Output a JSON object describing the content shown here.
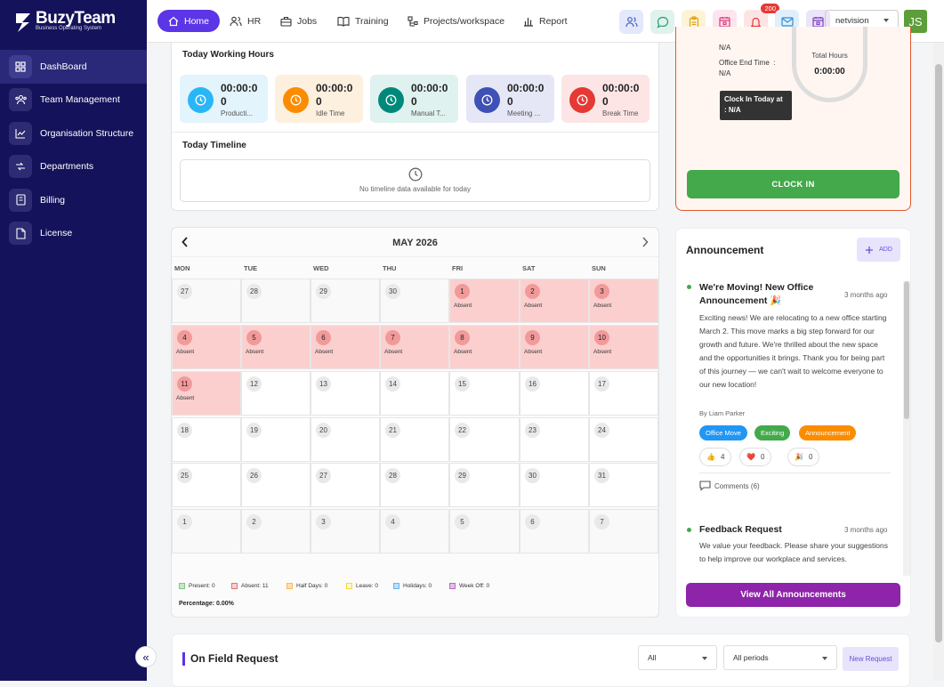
{
  "brand": {
    "name": "BuzyTeam",
    "tagline": "Business Operating System"
  },
  "sidebar": {
    "items": [
      {
        "label": "DashBoard",
        "icon": "grid-icon",
        "active": true
      },
      {
        "label": "Team Management",
        "icon": "team-icon"
      },
      {
        "label": "Organisation Structure",
        "icon": "chart-icon"
      },
      {
        "label": "Departments",
        "icon": "departments-icon"
      },
      {
        "label": "Billing",
        "icon": "billing-icon"
      },
      {
        "label": "License",
        "icon": "license-icon"
      }
    ],
    "collapse": "«"
  },
  "topnav": {
    "home": "Home",
    "hr": "HR",
    "jobs": "Jobs",
    "training": "Training",
    "projects": "Projects/workspace",
    "report": "Report"
  },
  "topbar": {
    "notification_count": "200",
    "org": "netvision",
    "avatar": "JS"
  },
  "working_hours": {
    "title": "Today Working Hours",
    "tiles": [
      {
        "value": "00:00:00",
        "label": "Producti...",
        "color": "#29b6f6",
        "bg": "#e3f4fc"
      },
      {
        "value": "00:00:00",
        "label": "Idle Time",
        "color": "#fb8c00",
        "bg": "#fdf0df"
      },
      {
        "value": "00:00:00",
        "label": "Manual T...",
        "color": "#00897b",
        "bg": "#dff2ef"
      },
      {
        "value": "00:00:00",
        "label": "Meeting ...",
        "color": "#3f51b5",
        "bg": "#e5e7f6"
      },
      {
        "value": "00:00:00",
        "label": "Break Time",
        "color": "#e53935",
        "bg": "#fde5e5"
      }
    ]
  },
  "timeline": {
    "title": "Today Timeline",
    "empty": "No timeline data available for today"
  },
  "calendar": {
    "month": "MAY 2026",
    "weekdays": [
      "MON",
      "TUE",
      "WED",
      "THU",
      "FRI",
      "SAT",
      "SUN"
    ],
    "weeks": [
      [
        {
          "d": "27",
          "m": 1
        },
        {
          "d": "28",
          "m": 1
        },
        {
          "d": "29",
          "m": 1
        },
        {
          "d": "30",
          "m": 1
        },
        {
          "d": "1",
          "s": "Absent"
        },
        {
          "d": "2",
          "s": "Absent"
        },
        {
          "d": "3",
          "s": "Absent"
        }
      ],
      [
        {
          "d": "4",
          "s": "Absent"
        },
        {
          "d": "5",
          "s": "Absent"
        },
        {
          "d": "6",
          "s": "Absent"
        },
        {
          "d": "7",
          "s": "Absent"
        },
        {
          "d": "8",
          "s": "Absent"
        },
        {
          "d": "9",
          "s": "Absent"
        },
        {
          "d": "10",
          "s": "Absent"
        }
      ],
      [
        {
          "d": "11",
          "s": "Absent"
        },
        {
          "d": "12"
        },
        {
          "d": "13"
        },
        {
          "d": "14"
        },
        {
          "d": "15"
        },
        {
          "d": "16"
        },
        {
          "d": "17"
        }
      ],
      [
        {
          "d": "18"
        },
        {
          "d": "19"
        },
        {
          "d": "20"
        },
        {
          "d": "21"
        },
        {
          "d": "22"
        },
        {
          "d": "23"
        },
        {
          "d": "24"
        }
      ],
      [
        {
          "d": "25"
        },
        {
          "d": "26"
        },
        {
          "d": "27"
        },
        {
          "d": "28"
        },
        {
          "d": "29"
        },
        {
          "d": "30"
        },
        {
          "d": "31"
        }
      ],
      [
        {
          "d": "1",
          "m": 1
        },
        {
          "d": "2",
          "m": 1
        },
        {
          "d": "3",
          "m": 1
        },
        {
          "d": "4",
          "m": 1
        },
        {
          "d": "5",
          "m": 1
        },
        {
          "d": "6",
          "m": 1
        },
        {
          "d": "7",
          "m": 1
        }
      ]
    ],
    "legend": [
      {
        "label": "Present: 0",
        "color": "#c8e6c9",
        "border": "#81c784"
      },
      {
        "label": "Absent: 11",
        "color": "#fccfcf",
        "border": "#e57373"
      },
      {
        "label": "Half Days: 0",
        "color": "#ffe0b2",
        "border": "#ffb74d"
      },
      {
        "label": "Leave: 0",
        "color": "#fff9c4",
        "border": "#fdd835"
      },
      {
        "label": "Holidays: 0",
        "color": "#bbdefb",
        "border": "#64b5f6"
      },
      {
        "label": "Week Off: 0",
        "color": "#e1bee7",
        "border": "#ba68c8"
      }
    ],
    "percentage": "Percentage: 0.00%"
  },
  "clock": {
    "start_na": "N/A",
    "end_label": "Office End Time  :",
    "end_value": "N/A",
    "total_label": "Total Hours",
    "total_value": "0:00:00",
    "tooltip_line1": "Clock In Today at",
    "tooltip_line2": ": N/A",
    "button": "CLOCK IN"
  },
  "announcement": {
    "title": "Announcement",
    "add": "ADD",
    "items": [
      {
        "title": "We're Moving! New Office Announcement 🎉",
        "time": "3 months ago",
        "body": "Exciting news! We are relocating to a new office starting March 2. This move marks a big step forward for our growth and future. We're thrilled about the new space and the opportunities it brings. Thank you for being part of this journey — we can't wait to welcome everyone to our new location!",
        "author": "By Liam Parker",
        "tags": [
          {
            "label": "Office Move",
            "color": "#2196f3"
          },
          {
            "label": "Exciting",
            "color": "#43a94b"
          },
          {
            "label": "Announcement",
            "color": "#fb8c00"
          }
        ],
        "reactions": [
          {
            "emoji": "👍",
            "count": "4"
          },
          {
            "emoji": "❤️",
            "count": "0"
          },
          {
            "emoji": "🎉",
            "count": "0"
          }
        ],
        "comments": "Comments (6)"
      },
      {
        "title": "Feedback Request",
        "time": "3 months ago",
        "body": "We value your feedback. Please share your suggestions to help improve our workplace and services."
      }
    ],
    "view_all": "View All Announcements"
  },
  "field_request": {
    "title": "On Field Request",
    "filter1": "All",
    "filter2": "All periods",
    "new_button": "New Request"
  }
}
